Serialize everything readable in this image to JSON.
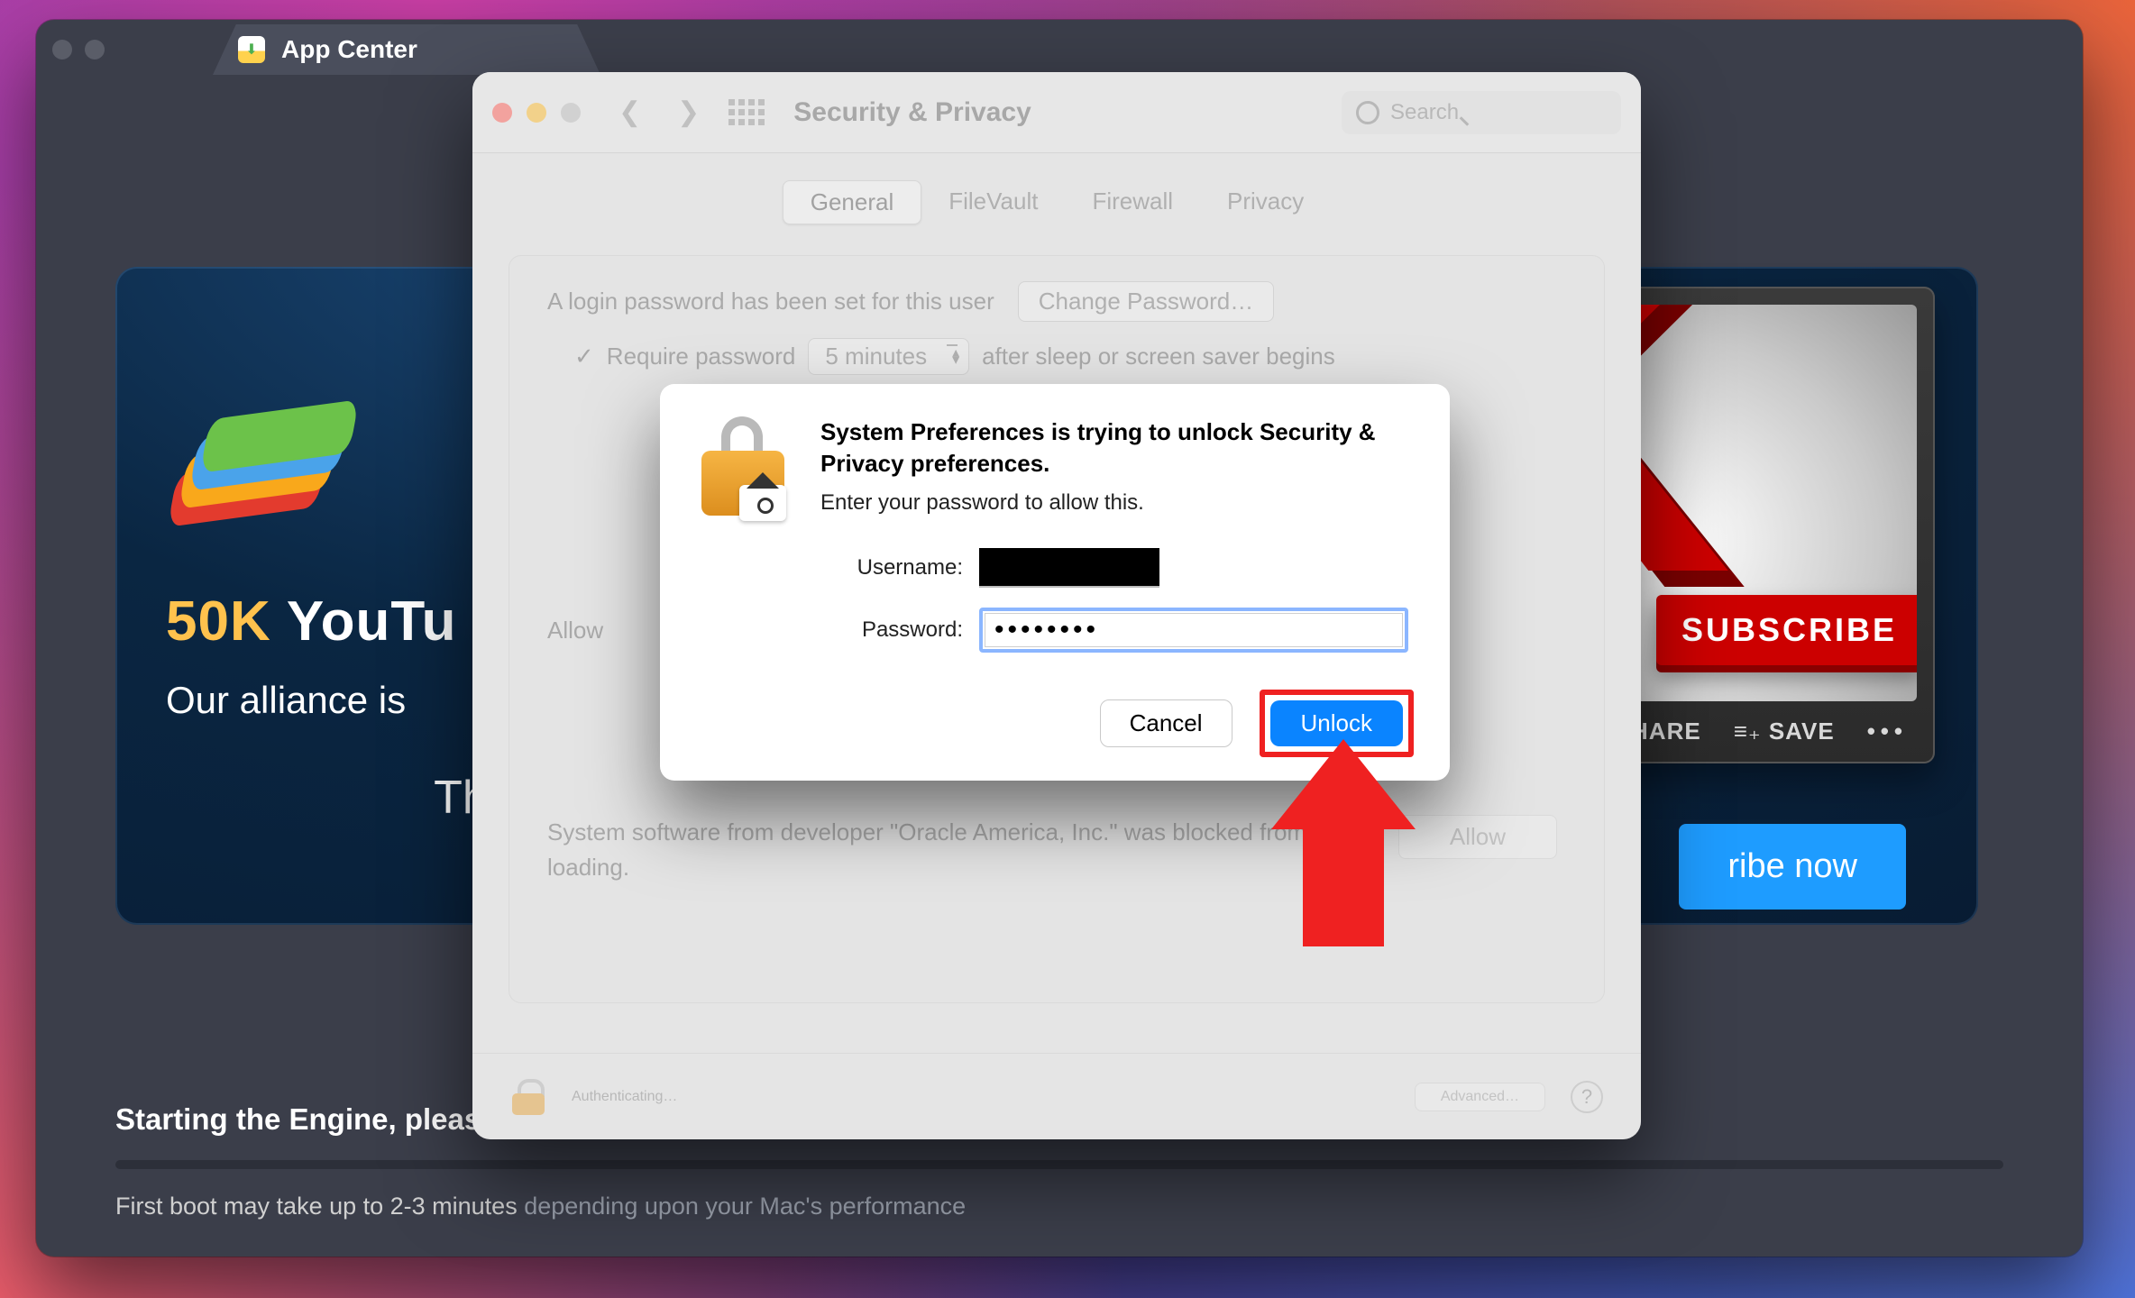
{
  "app_window": {
    "tab_label": "App Center",
    "promo": {
      "headline_pre": "50K",
      "headline_rest": " YouTu",
      "subline": "Our alliance is",
      "thanks": "Tha",
      "video": {
        "subscribe_pill": "SUBSCRIBE",
        "share": "SHARE",
        "save": "SAVE",
        "more": "•••"
      },
      "cta": "ribe now"
    },
    "status": {
      "line1": "Starting the Engine, please wait",
      "line2a": "First boot may take up to 2-3 minutes ",
      "line2b": "depending upon your Mac's performance"
    }
  },
  "pref": {
    "title": "Security & Privacy",
    "search_placeholder": "Search",
    "tabs": {
      "general": "General",
      "filevault": "FileVault",
      "firewall": "Firewall",
      "privacy": "Privacy"
    },
    "login_text": "A login password has been set for this user",
    "change_pw": "Change Password…",
    "require_pw": "Require password",
    "delay": "5 minutes",
    "after_text": "after sleep or screen saver begins",
    "allow_label": "Allow",
    "blocked_text": "System software from developer \"Oracle America, Inc.\" was blocked from loading.",
    "allow_btn": "Allow",
    "auth_status": "Authenticating…",
    "advanced": "Advanced…"
  },
  "auth": {
    "heading": "System Preferences is trying to unlock Security & Privacy preferences.",
    "sub": "Enter your password to allow this.",
    "username_label": "Username:",
    "password_label": "Password:",
    "password_value": "••••••••",
    "cancel": "Cancel",
    "unlock": "Unlock"
  }
}
